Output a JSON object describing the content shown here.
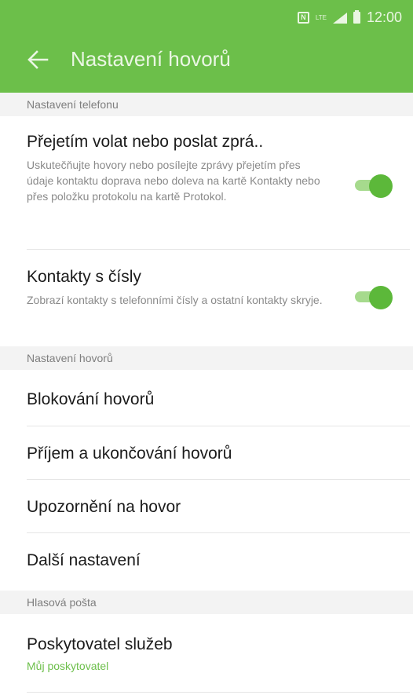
{
  "status_bar": {
    "time": "12:00",
    "icons": [
      "nfc-icon",
      "lte-icon",
      "signal-icon",
      "battery-icon"
    ],
    "nfc_glyph": "N",
    "lte_label": "LTE"
  },
  "app_bar": {
    "title": "Nastavení hovorů",
    "back_icon": "back-arrow-icon",
    "color": "#6cbf4a"
  },
  "sections": [
    {
      "header": "Nastavení telefonu"
    },
    {
      "header": "Nastavení hovorů"
    },
    {
      "header": "Hlasová pošta"
    }
  ],
  "items": {
    "swipe": {
      "title": "Přejetím volat nebo poslat zprá..",
      "desc": "Uskutečňujte hovory nebo posílejte zprávy přejetím přes údaje kontaktu doprava nebo doleva na kartě Kontakty nebo přes položku protokolu na kartě Protokol.",
      "toggle_on": true
    },
    "contacts_numbers": {
      "title": "Kontakty s čísly",
      "desc": "Zobrazí kontakty s telefonními čísly a ostatní kontakty skryje.",
      "toggle_on": true
    },
    "call_blocking": {
      "title": "Blokování hovorů"
    },
    "answer_end": {
      "title": "Příjem a ukončování hovorů"
    },
    "call_alerts": {
      "title": "Upozornění na hovor"
    },
    "more_settings": {
      "title": "Další nastavení"
    },
    "service_provider": {
      "title": "Poskytovatel služeb",
      "subtitle": "Můj poskytovatel"
    }
  },
  "colors": {
    "accent": "#6cbf4a",
    "toggle_knob": "#5cb83a",
    "toggle_track": "#a6da8d",
    "section_bg": "#f3f3f3"
  }
}
